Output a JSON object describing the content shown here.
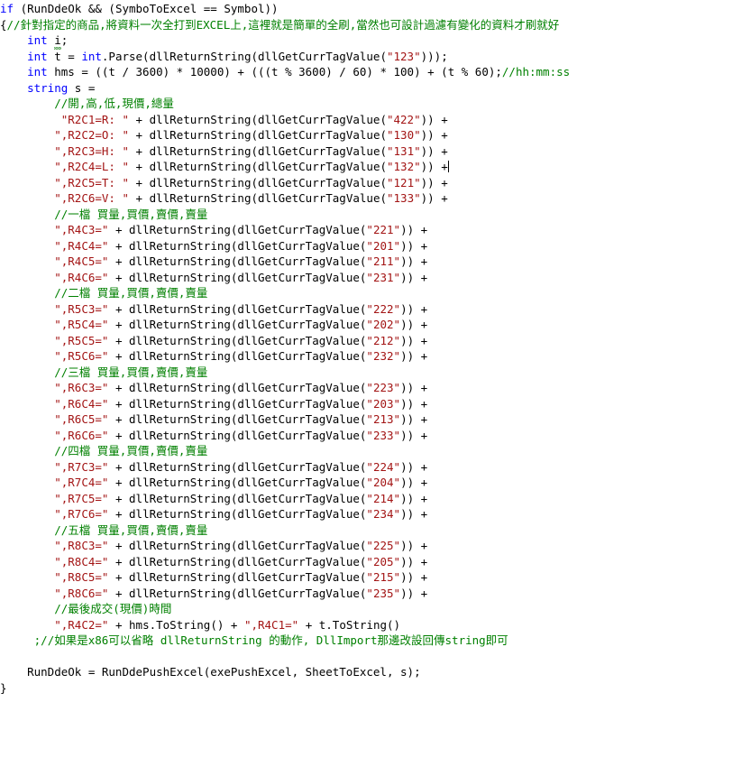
{
  "editor": {
    "language": "csharp",
    "colors": {
      "background": "#ffffff",
      "plain": "#000000",
      "keyword": "#0000ff",
      "comment": "#008000",
      "string": "#a31515",
      "squiggle": "#4a9c4a",
      "caret": "#000000"
    },
    "font_size_px": 12.5,
    "line_height_px": 17.5,
    "caret": {
      "line_index": 10,
      "after_text": "+"
    }
  },
  "code": {
    "lines": [
      {
        "index": 0,
        "tokens": [
          {
            "t": "keyword",
            "s": "if"
          },
          {
            "t": "plain",
            "s": " (RunDdeOk && (SymboToExcel == Symbol))"
          }
        ]
      },
      {
        "index": 1,
        "tokens": [
          {
            "t": "plain",
            "s": "{"
          },
          {
            "t": "comment",
            "s": "//針對指定的商品,將資料一次全打到EXCEL上,這裡就是簡單的全刷,當然也可設計過濾有變化的資料才刷就好"
          }
        ]
      },
      {
        "index": 2,
        "tokens": [
          {
            "t": "plain",
            "s": "    "
          },
          {
            "t": "keyword",
            "s": "int"
          },
          {
            "t": "plain",
            "s": " "
          },
          {
            "t": "squiggle",
            "s": "i"
          },
          {
            "t": "plain",
            "s": ";"
          }
        ]
      },
      {
        "index": 3,
        "tokens": [
          {
            "t": "plain",
            "s": "    "
          },
          {
            "t": "keyword",
            "s": "int"
          },
          {
            "t": "plain",
            "s": " t = "
          },
          {
            "t": "keyword",
            "s": "int"
          },
          {
            "t": "plain",
            "s": ".Parse(dllReturnString(dllGetCurrTagValue("
          },
          {
            "t": "string",
            "s": "\"123\""
          },
          {
            "t": "plain",
            "s": ")));"
          }
        ]
      },
      {
        "index": 4,
        "tokens": [
          {
            "t": "plain",
            "s": "    "
          },
          {
            "t": "keyword",
            "s": "int"
          },
          {
            "t": "plain",
            "s": " hms = ((t / 3600) * 10000) + (((t % 3600) / 60) * 100) + (t % 60);"
          },
          {
            "t": "comment",
            "s": "//hh:mm:ss"
          }
        ]
      },
      {
        "index": 5,
        "tokens": [
          {
            "t": "plain",
            "s": "    "
          },
          {
            "t": "keyword",
            "s": "string"
          },
          {
            "t": "plain",
            "s": " s ="
          }
        ]
      },
      {
        "index": 6,
        "tokens": [
          {
            "t": "plain",
            "s": "        "
          },
          {
            "t": "comment",
            "s": "//開,高,低,現價,總量"
          }
        ]
      },
      {
        "index": 7,
        "tokens": [
          {
            "t": "plain",
            "s": "         "
          },
          {
            "t": "string",
            "s": "\"R2C1=R: \""
          },
          {
            "t": "plain",
            "s": " + dllReturnString(dllGetCurrTagValue("
          },
          {
            "t": "string",
            "s": "\"422\""
          },
          {
            "t": "plain",
            "s": ")) +"
          }
        ]
      },
      {
        "index": 8,
        "tokens": [
          {
            "t": "plain",
            "s": "        "
          },
          {
            "t": "string",
            "s": "\",R2C2=O: \""
          },
          {
            "t": "plain",
            "s": " + dllReturnString(dllGetCurrTagValue("
          },
          {
            "t": "string",
            "s": "\"130\""
          },
          {
            "t": "plain",
            "s": ")) +"
          }
        ]
      },
      {
        "index": 9,
        "tokens": [
          {
            "t": "plain",
            "s": "        "
          },
          {
            "t": "string",
            "s": "\",R2C3=H: \""
          },
          {
            "t": "plain",
            "s": " + dllReturnString(dllGetCurrTagValue("
          },
          {
            "t": "string",
            "s": "\"131\""
          },
          {
            "t": "plain",
            "s": ")) +"
          }
        ]
      },
      {
        "index": 10,
        "tokens": [
          {
            "t": "plain",
            "s": "        "
          },
          {
            "t": "string",
            "s": "\",R2C4=L: \""
          },
          {
            "t": "plain",
            "s": " + dllReturnString(dllGetCurrTagValue("
          },
          {
            "t": "string",
            "s": "\"132\""
          },
          {
            "t": "plain",
            "s": ")) +"
          },
          {
            "t": "caret",
            "s": ""
          }
        ]
      },
      {
        "index": 11,
        "tokens": [
          {
            "t": "plain",
            "s": "        "
          },
          {
            "t": "string",
            "s": "\",R2C5=T: \""
          },
          {
            "t": "plain",
            "s": " + dllReturnString(dllGetCurrTagValue("
          },
          {
            "t": "string",
            "s": "\"121\""
          },
          {
            "t": "plain",
            "s": ")) +"
          }
        ]
      },
      {
        "index": 12,
        "tokens": [
          {
            "t": "plain",
            "s": "        "
          },
          {
            "t": "string",
            "s": "\",R2C6=V: \""
          },
          {
            "t": "plain",
            "s": " + dllReturnString(dllGetCurrTagValue("
          },
          {
            "t": "string",
            "s": "\"133\""
          },
          {
            "t": "plain",
            "s": ")) +"
          }
        ]
      },
      {
        "index": 13,
        "tokens": [
          {
            "t": "plain",
            "s": "        "
          },
          {
            "t": "comment",
            "s": "//一檔 買量,買價,賣價,賣量"
          }
        ]
      },
      {
        "index": 14,
        "tokens": [
          {
            "t": "plain",
            "s": "        "
          },
          {
            "t": "string",
            "s": "\",R4C3=\""
          },
          {
            "t": "plain",
            "s": " + dllReturnString(dllGetCurrTagValue("
          },
          {
            "t": "string",
            "s": "\"221\""
          },
          {
            "t": "plain",
            "s": ")) +"
          }
        ]
      },
      {
        "index": 15,
        "tokens": [
          {
            "t": "plain",
            "s": "        "
          },
          {
            "t": "string",
            "s": "\",R4C4=\""
          },
          {
            "t": "plain",
            "s": " + dllReturnString(dllGetCurrTagValue("
          },
          {
            "t": "string",
            "s": "\"201\""
          },
          {
            "t": "plain",
            "s": ")) +"
          }
        ]
      },
      {
        "index": 16,
        "tokens": [
          {
            "t": "plain",
            "s": "        "
          },
          {
            "t": "string",
            "s": "\",R4C5=\""
          },
          {
            "t": "plain",
            "s": " + dllReturnString(dllGetCurrTagValue("
          },
          {
            "t": "string",
            "s": "\"211\""
          },
          {
            "t": "plain",
            "s": ")) +"
          }
        ]
      },
      {
        "index": 17,
        "tokens": [
          {
            "t": "plain",
            "s": "        "
          },
          {
            "t": "string",
            "s": "\",R4C6=\""
          },
          {
            "t": "plain",
            "s": " + dllReturnString(dllGetCurrTagValue("
          },
          {
            "t": "string",
            "s": "\"231\""
          },
          {
            "t": "plain",
            "s": ")) +"
          }
        ]
      },
      {
        "index": 18,
        "tokens": [
          {
            "t": "plain",
            "s": "        "
          },
          {
            "t": "comment",
            "s": "//二檔 買量,買價,賣價,賣量"
          }
        ]
      },
      {
        "index": 19,
        "tokens": [
          {
            "t": "plain",
            "s": "        "
          },
          {
            "t": "string",
            "s": "\",R5C3=\""
          },
          {
            "t": "plain",
            "s": " + dllReturnString(dllGetCurrTagValue("
          },
          {
            "t": "string",
            "s": "\"222\""
          },
          {
            "t": "plain",
            "s": ")) +"
          }
        ]
      },
      {
        "index": 20,
        "tokens": [
          {
            "t": "plain",
            "s": "        "
          },
          {
            "t": "string",
            "s": "\",R5C4=\""
          },
          {
            "t": "plain",
            "s": " + dllReturnString(dllGetCurrTagValue("
          },
          {
            "t": "string",
            "s": "\"202\""
          },
          {
            "t": "plain",
            "s": ")) +"
          }
        ]
      },
      {
        "index": 21,
        "tokens": [
          {
            "t": "plain",
            "s": "        "
          },
          {
            "t": "string",
            "s": "\",R5C5=\""
          },
          {
            "t": "plain",
            "s": " + dllReturnString(dllGetCurrTagValue("
          },
          {
            "t": "string",
            "s": "\"212\""
          },
          {
            "t": "plain",
            "s": ")) +"
          }
        ]
      },
      {
        "index": 22,
        "tokens": [
          {
            "t": "plain",
            "s": "        "
          },
          {
            "t": "string",
            "s": "\",R5C6=\""
          },
          {
            "t": "plain",
            "s": " + dllReturnString(dllGetCurrTagValue("
          },
          {
            "t": "string",
            "s": "\"232\""
          },
          {
            "t": "plain",
            "s": ")) +"
          }
        ]
      },
      {
        "index": 23,
        "tokens": [
          {
            "t": "plain",
            "s": "        "
          },
          {
            "t": "comment",
            "s": "//三檔 買量,買價,賣價,賣量"
          }
        ]
      },
      {
        "index": 24,
        "tokens": [
          {
            "t": "plain",
            "s": "        "
          },
          {
            "t": "string",
            "s": "\",R6C3=\""
          },
          {
            "t": "plain",
            "s": " + dllReturnString(dllGetCurrTagValue("
          },
          {
            "t": "string",
            "s": "\"223\""
          },
          {
            "t": "plain",
            "s": ")) +"
          }
        ]
      },
      {
        "index": 25,
        "tokens": [
          {
            "t": "plain",
            "s": "        "
          },
          {
            "t": "string",
            "s": "\",R6C4=\""
          },
          {
            "t": "plain",
            "s": " + dllReturnString(dllGetCurrTagValue("
          },
          {
            "t": "string",
            "s": "\"203\""
          },
          {
            "t": "plain",
            "s": ")) +"
          }
        ]
      },
      {
        "index": 26,
        "tokens": [
          {
            "t": "plain",
            "s": "        "
          },
          {
            "t": "string",
            "s": "\",R6C5=\""
          },
          {
            "t": "plain",
            "s": " + dllReturnString(dllGetCurrTagValue("
          },
          {
            "t": "string",
            "s": "\"213\""
          },
          {
            "t": "plain",
            "s": ")) +"
          }
        ]
      },
      {
        "index": 27,
        "tokens": [
          {
            "t": "plain",
            "s": "        "
          },
          {
            "t": "string",
            "s": "\",R6C6=\""
          },
          {
            "t": "plain",
            "s": " + dllReturnString(dllGetCurrTagValue("
          },
          {
            "t": "string",
            "s": "\"233\""
          },
          {
            "t": "plain",
            "s": ")) +"
          }
        ]
      },
      {
        "index": 28,
        "tokens": [
          {
            "t": "plain",
            "s": "        "
          },
          {
            "t": "comment",
            "s": "//四檔 買量,買價,賣價,賣量"
          }
        ]
      },
      {
        "index": 29,
        "tokens": [
          {
            "t": "plain",
            "s": "        "
          },
          {
            "t": "string",
            "s": "\",R7C3=\""
          },
          {
            "t": "plain",
            "s": " + dllReturnString(dllGetCurrTagValue("
          },
          {
            "t": "string",
            "s": "\"224\""
          },
          {
            "t": "plain",
            "s": ")) +"
          }
        ]
      },
      {
        "index": 30,
        "tokens": [
          {
            "t": "plain",
            "s": "        "
          },
          {
            "t": "string",
            "s": "\",R7C4=\""
          },
          {
            "t": "plain",
            "s": " + dllReturnString(dllGetCurrTagValue("
          },
          {
            "t": "string",
            "s": "\"204\""
          },
          {
            "t": "plain",
            "s": ")) +"
          }
        ]
      },
      {
        "index": 31,
        "tokens": [
          {
            "t": "plain",
            "s": "        "
          },
          {
            "t": "string",
            "s": "\",R7C5=\""
          },
          {
            "t": "plain",
            "s": " + dllReturnString(dllGetCurrTagValue("
          },
          {
            "t": "string",
            "s": "\"214\""
          },
          {
            "t": "plain",
            "s": ")) +"
          }
        ]
      },
      {
        "index": 32,
        "tokens": [
          {
            "t": "plain",
            "s": "        "
          },
          {
            "t": "string",
            "s": "\",R7C6=\""
          },
          {
            "t": "plain",
            "s": " + dllReturnString(dllGetCurrTagValue("
          },
          {
            "t": "string",
            "s": "\"234\""
          },
          {
            "t": "plain",
            "s": ")) +"
          }
        ]
      },
      {
        "index": 33,
        "tokens": [
          {
            "t": "plain",
            "s": "        "
          },
          {
            "t": "comment",
            "s": "//五檔 買量,買價,賣價,賣量"
          }
        ]
      },
      {
        "index": 34,
        "tokens": [
          {
            "t": "plain",
            "s": "        "
          },
          {
            "t": "string",
            "s": "\",R8C3=\""
          },
          {
            "t": "plain",
            "s": " + dllReturnString(dllGetCurrTagValue("
          },
          {
            "t": "string",
            "s": "\"225\""
          },
          {
            "t": "plain",
            "s": ")) +"
          }
        ]
      },
      {
        "index": 35,
        "tokens": [
          {
            "t": "plain",
            "s": "        "
          },
          {
            "t": "string",
            "s": "\",R8C4=\""
          },
          {
            "t": "plain",
            "s": " + dllReturnString(dllGetCurrTagValue("
          },
          {
            "t": "string",
            "s": "\"205\""
          },
          {
            "t": "plain",
            "s": ")) +"
          }
        ]
      },
      {
        "index": 36,
        "tokens": [
          {
            "t": "plain",
            "s": "        "
          },
          {
            "t": "string",
            "s": "\",R8C5=\""
          },
          {
            "t": "plain",
            "s": " + dllReturnString(dllGetCurrTagValue("
          },
          {
            "t": "string",
            "s": "\"215\""
          },
          {
            "t": "plain",
            "s": ")) +"
          }
        ]
      },
      {
        "index": 37,
        "tokens": [
          {
            "t": "plain",
            "s": "        "
          },
          {
            "t": "string",
            "s": "\",R8C6=\""
          },
          {
            "t": "plain",
            "s": " + dllReturnString(dllGetCurrTagValue("
          },
          {
            "t": "string",
            "s": "\"235\""
          },
          {
            "t": "plain",
            "s": ")) +"
          }
        ]
      },
      {
        "index": 38,
        "tokens": [
          {
            "t": "plain",
            "s": "        "
          },
          {
            "t": "comment",
            "s": "//最後成交(現價)時間"
          }
        ]
      },
      {
        "index": 39,
        "tokens": [
          {
            "t": "plain",
            "s": "        "
          },
          {
            "t": "string",
            "s": "\",R4C2=\""
          },
          {
            "t": "plain",
            "s": " + hms.ToString() + "
          },
          {
            "t": "string",
            "s": "\",R4C1=\""
          },
          {
            "t": "plain",
            "s": " + t.ToString()"
          }
        ]
      },
      {
        "index": 40,
        "tokens": [
          {
            "t": "plain",
            "s": "     "
          },
          {
            "t": "comment",
            "s": ";//如果是x86可以省略 dllReturnString 的動作, DllImport那邊改設回傳string即可"
          }
        ]
      },
      {
        "index": 41,
        "tokens": [
          {
            "t": "plain",
            "s": ""
          }
        ]
      },
      {
        "index": 42,
        "tokens": [
          {
            "t": "plain",
            "s": "    RunDdeOk = RunDdePushExcel(exePushExcel, SheetToExcel, s);"
          }
        ]
      },
      {
        "index": 43,
        "tokens": [
          {
            "t": "plain",
            "s": "}"
          }
        ]
      }
    ]
  }
}
